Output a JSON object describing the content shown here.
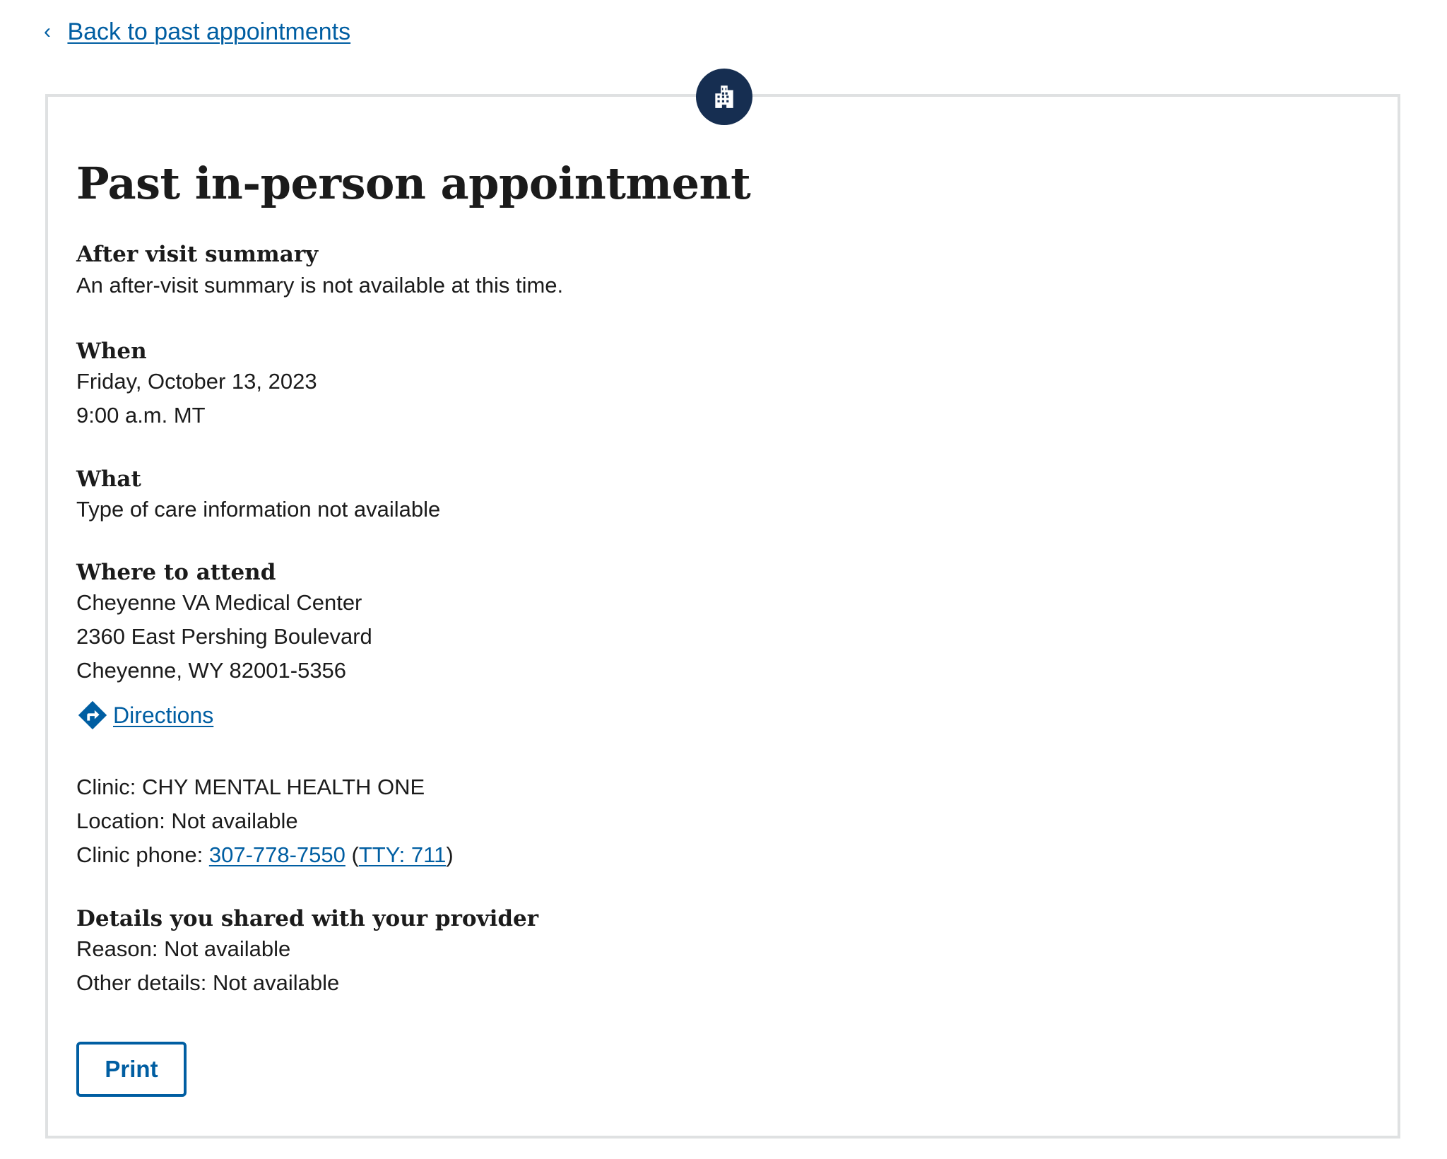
{
  "back_link": {
    "label": "Back to past appointments"
  },
  "page_title": "Past in-person appointment",
  "after_visit": {
    "heading": "After visit summary",
    "text": "An after-visit summary is not available at this time."
  },
  "when": {
    "heading": "When",
    "date": "Friday, October 13, 2023",
    "time": "9:00 a.m. MT"
  },
  "what": {
    "heading": "What",
    "text": "Type of care information not available"
  },
  "where": {
    "heading": "Where to attend",
    "facility": "Cheyenne VA Medical Center",
    "street": "2360 East Pershing Boulevard",
    "city_line": "Cheyenne, WY 82001-5356",
    "directions_label": "Directions"
  },
  "clinic": {
    "clinic_line": "Clinic: CHY MENTAL HEALTH ONE",
    "location_line": "Location: Not available",
    "phone_prefix": "Clinic phone: ",
    "phone": "307-778-7550",
    "tty": "TTY: 711"
  },
  "details": {
    "heading": "Details you shared with your provider",
    "reason": "Reason: Not available",
    "other": "Other details: Not available"
  },
  "print_label": "Print",
  "icons": {
    "badge": "building-icon",
    "directions": "directions-icon",
    "back": "chevron-left-icon"
  },
  "colors": {
    "link": "#005ea2",
    "badge_bg": "#162e51",
    "border": "#dfe1e2"
  }
}
